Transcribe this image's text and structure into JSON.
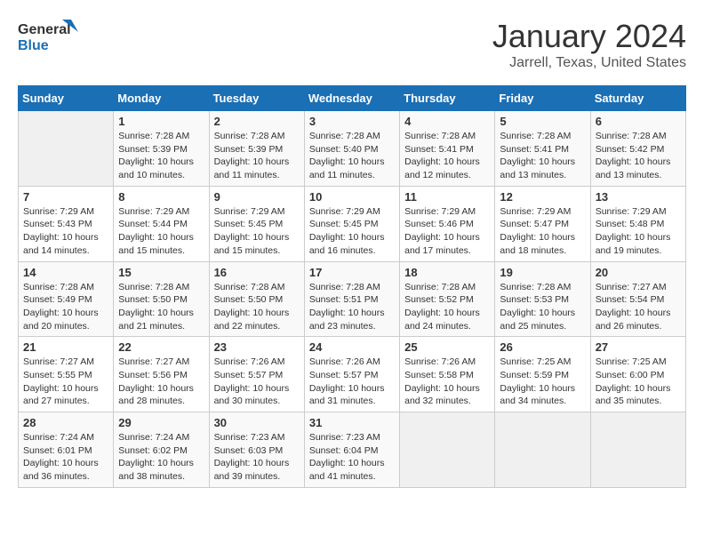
{
  "header": {
    "logo_line1": "General",
    "logo_line2": "Blue",
    "title": "January 2024",
    "subtitle": "Jarrell, Texas, United States"
  },
  "days_of_week": [
    "Sunday",
    "Monday",
    "Tuesday",
    "Wednesday",
    "Thursday",
    "Friday",
    "Saturday"
  ],
  "weeks": [
    [
      {
        "day": "",
        "info": ""
      },
      {
        "day": "1",
        "info": "Sunrise: 7:28 AM\nSunset: 5:39 PM\nDaylight: 10 hours\nand 10 minutes."
      },
      {
        "day": "2",
        "info": "Sunrise: 7:28 AM\nSunset: 5:39 PM\nDaylight: 10 hours\nand 11 minutes."
      },
      {
        "day": "3",
        "info": "Sunrise: 7:28 AM\nSunset: 5:40 PM\nDaylight: 10 hours\nand 11 minutes."
      },
      {
        "day": "4",
        "info": "Sunrise: 7:28 AM\nSunset: 5:41 PM\nDaylight: 10 hours\nand 12 minutes."
      },
      {
        "day": "5",
        "info": "Sunrise: 7:28 AM\nSunset: 5:41 PM\nDaylight: 10 hours\nand 13 minutes."
      },
      {
        "day": "6",
        "info": "Sunrise: 7:28 AM\nSunset: 5:42 PM\nDaylight: 10 hours\nand 13 minutes."
      }
    ],
    [
      {
        "day": "7",
        "info": "Sunrise: 7:29 AM\nSunset: 5:43 PM\nDaylight: 10 hours\nand 14 minutes."
      },
      {
        "day": "8",
        "info": "Sunrise: 7:29 AM\nSunset: 5:44 PM\nDaylight: 10 hours\nand 15 minutes."
      },
      {
        "day": "9",
        "info": "Sunrise: 7:29 AM\nSunset: 5:45 PM\nDaylight: 10 hours\nand 15 minutes."
      },
      {
        "day": "10",
        "info": "Sunrise: 7:29 AM\nSunset: 5:45 PM\nDaylight: 10 hours\nand 16 minutes."
      },
      {
        "day": "11",
        "info": "Sunrise: 7:29 AM\nSunset: 5:46 PM\nDaylight: 10 hours\nand 17 minutes."
      },
      {
        "day": "12",
        "info": "Sunrise: 7:29 AM\nSunset: 5:47 PM\nDaylight: 10 hours\nand 18 minutes."
      },
      {
        "day": "13",
        "info": "Sunrise: 7:29 AM\nSunset: 5:48 PM\nDaylight: 10 hours\nand 19 minutes."
      }
    ],
    [
      {
        "day": "14",
        "info": "Sunrise: 7:28 AM\nSunset: 5:49 PM\nDaylight: 10 hours\nand 20 minutes."
      },
      {
        "day": "15",
        "info": "Sunrise: 7:28 AM\nSunset: 5:50 PM\nDaylight: 10 hours\nand 21 minutes."
      },
      {
        "day": "16",
        "info": "Sunrise: 7:28 AM\nSunset: 5:50 PM\nDaylight: 10 hours\nand 22 minutes."
      },
      {
        "day": "17",
        "info": "Sunrise: 7:28 AM\nSunset: 5:51 PM\nDaylight: 10 hours\nand 23 minutes."
      },
      {
        "day": "18",
        "info": "Sunrise: 7:28 AM\nSunset: 5:52 PM\nDaylight: 10 hours\nand 24 minutes."
      },
      {
        "day": "19",
        "info": "Sunrise: 7:28 AM\nSunset: 5:53 PM\nDaylight: 10 hours\nand 25 minutes."
      },
      {
        "day": "20",
        "info": "Sunrise: 7:27 AM\nSunset: 5:54 PM\nDaylight: 10 hours\nand 26 minutes."
      }
    ],
    [
      {
        "day": "21",
        "info": "Sunrise: 7:27 AM\nSunset: 5:55 PM\nDaylight: 10 hours\nand 27 minutes."
      },
      {
        "day": "22",
        "info": "Sunrise: 7:27 AM\nSunset: 5:56 PM\nDaylight: 10 hours\nand 28 minutes."
      },
      {
        "day": "23",
        "info": "Sunrise: 7:26 AM\nSunset: 5:57 PM\nDaylight: 10 hours\nand 30 minutes."
      },
      {
        "day": "24",
        "info": "Sunrise: 7:26 AM\nSunset: 5:57 PM\nDaylight: 10 hours\nand 31 minutes."
      },
      {
        "day": "25",
        "info": "Sunrise: 7:26 AM\nSunset: 5:58 PM\nDaylight: 10 hours\nand 32 minutes."
      },
      {
        "day": "26",
        "info": "Sunrise: 7:25 AM\nSunset: 5:59 PM\nDaylight: 10 hours\nand 34 minutes."
      },
      {
        "day": "27",
        "info": "Sunrise: 7:25 AM\nSunset: 6:00 PM\nDaylight: 10 hours\nand 35 minutes."
      }
    ],
    [
      {
        "day": "28",
        "info": "Sunrise: 7:24 AM\nSunset: 6:01 PM\nDaylight: 10 hours\nand 36 minutes."
      },
      {
        "day": "29",
        "info": "Sunrise: 7:24 AM\nSunset: 6:02 PM\nDaylight: 10 hours\nand 38 minutes."
      },
      {
        "day": "30",
        "info": "Sunrise: 7:23 AM\nSunset: 6:03 PM\nDaylight: 10 hours\nand 39 minutes."
      },
      {
        "day": "31",
        "info": "Sunrise: 7:23 AM\nSunset: 6:04 PM\nDaylight: 10 hours\nand 41 minutes."
      },
      {
        "day": "",
        "info": ""
      },
      {
        "day": "",
        "info": ""
      },
      {
        "day": "",
        "info": ""
      }
    ]
  ]
}
